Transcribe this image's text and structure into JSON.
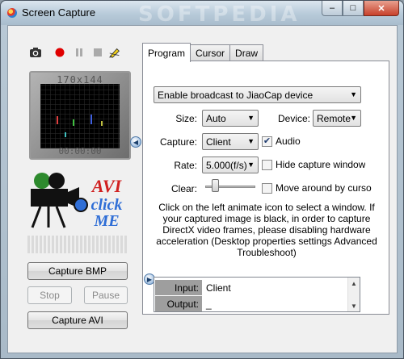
{
  "window": {
    "title": "Screen Capture",
    "watermark": "SOFTPEDIA",
    "controls": {
      "minimize": "–",
      "maximize": "□",
      "close": "✕"
    }
  },
  "toolbar": {
    "icons": [
      "camera-icon",
      "record-icon",
      "pause-icon",
      "stop-icon",
      "pencil-icon"
    ]
  },
  "preview": {
    "size": "170x144",
    "time": "00:00:00"
  },
  "logo": {
    "line1": "AVI",
    "line2": "click",
    "line3": "ME"
  },
  "buttons": {
    "capture_bmp": "Capture BMP",
    "stop": "Stop",
    "pause": "Pause",
    "capture_avi": "Capture AVI"
  },
  "tabs": [
    {
      "label": "Program",
      "active": true
    },
    {
      "label": "Cursor",
      "active": false
    },
    {
      "label": "Draw",
      "active": false
    }
  ],
  "program": {
    "broadcast": "Enable broadcast to JiaoCap device",
    "size_label": "Size:",
    "size_value": "Auto",
    "device_label": "Device:",
    "device_value": "Remote",
    "capture_label": "Capture:",
    "capture_value": "Client",
    "audio_label": "Audio",
    "audio_checked": true,
    "rate_label": "Rate:",
    "rate_value": "5.000(f/s)",
    "hide_label": "Hide capture window",
    "hide_checked": false,
    "clear_label": "Clear:",
    "clear_level": 0.15,
    "move_label": "Move around by curso",
    "move_checked": false,
    "info": "Click on the left animate icon to select a window. If your captured image is black, in order to capture DirectX video frames, please disabling hardware acceleration (Desktop properties settings Advanced Troubleshoot)"
  },
  "log": [
    {
      "key": "Input:",
      "value": "Client"
    },
    {
      "key": "Output:",
      "value": "_"
    }
  ],
  "colors": {
    "accent": "#7aa6d6",
    "close": "#c7412b",
    "record": "#e00000"
  }
}
